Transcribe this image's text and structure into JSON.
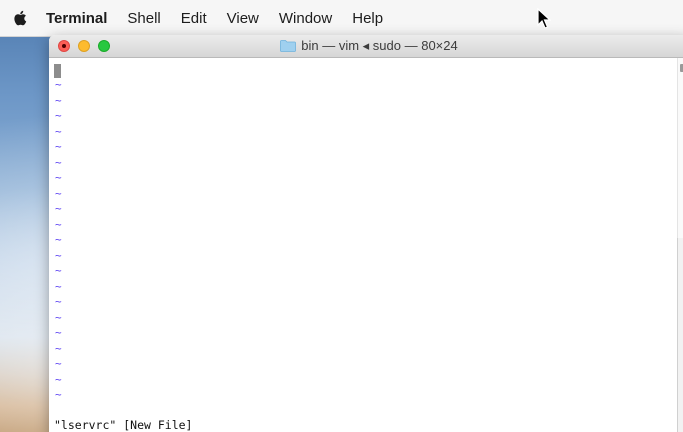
{
  "menubar": {
    "items": [
      "Terminal",
      "Shell",
      "Edit",
      "View",
      "Window",
      "Help"
    ]
  },
  "window": {
    "title": "bin — vim ◂ sudo — 80×24"
  },
  "editor": {
    "empty_line_marker": "~",
    "empty_line_count": 21,
    "status_line": "\"lservrc\" [New File]"
  },
  "colors": {
    "tilde": "#5a3ff2",
    "close": "#fc5f57",
    "minimize": "#fdbb2e",
    "maximize": "#28c840"
  }
}
